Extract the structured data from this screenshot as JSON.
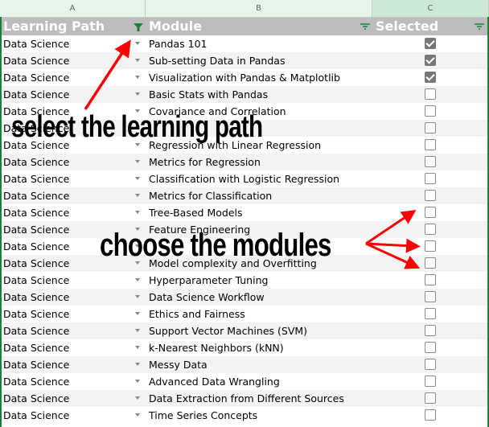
{
  "column_letters": [
    "A",
    "B",
    "C"
  ],
  "headers": {
    "learning_path": "Learning Path",
    "module": "Module",
    "selected": "Selected"
  },
  "colors": {
    "header_bg": "#bdbdbd",
    "filter_icon": "#188038",
    "annotation_arrow": "#ff0000",
    "checkbox_checked": "#777777"
  },
  "rows": [
    {
      "path": "Data Science",
      "module": "Pandas 101",
      "selected": true
    },
    {
      "path": "Data Science",
      "module": "Sub-setting Data in Pandas",
      "selected": true
    },
    {
      "path": "Data Science",
      "module": "Visualization with Pandas & Matplotlib",
      "selected": true
    },
    {
      "path": "Data Science",
      "module": "Basic Stats with Pandas",
      "selected": false
    },
    {
      "path": "Data Science",
      "module": "Covariance and Correlation",
      "selected": false
    },
    {
      "path": "Data Science",
      "module": "",
      "selected": false
    },
    {
      "path": "Data Science",
      "module": "Regression with Linear Regression",
      "selected": false
    },
    {
      "path": "Data Science",
      "module": "Metrics for Regression",
      "selected": false
    },
    {
      "path": "Data Science",
      "module": "Classification with Logistic Regression",
      "selected": false
    },
    {
      "path": "Data Science",
      "module": "Metrics for Classification",
      "selected": false
    },
    {
      "path": "Data Science",
      "module": "Tree-Based Models",
      "selected": false
    },
    {
      "path": "Data Science",
      "module": "Feature Engineering",
      "selected": false
    },
    {
      "path": "Data Science",
      "module": "",
      "selected": false
    },
    {
      "path": "Data Science",
      "module": "Model complexity and Overfitting",
      "selected": false
    },
    {
      "path": "Data Science",
      "module": "Hyperparameter Tuning",
      "selected": false
    },
    {
      "path": "Data Science",
      "module": "Data Science Workflow",
      "selected": false
    },
    {
      "path": "Data Science",
      "module": "Ethics and Fairness",
      "selected": false
    },
    {
      "path": "Data Science",
      "module": "Support Vector Machines (SVM)",
      "selected": false
    },
    {
      "path": "Data Science",
      "module": "k-Nearest Neighbors (kNN)",
      "selected": false
    },
    {
      "path": "Data Science",
      "module": "Messy Data",
      "selected": false
    },
    {
      "path": "Data Science",
      "module": "Advanced Data Wrangling",
      "selected": false
    },
    {
      "path": "Data Science",
      "module": "Data Extraction from Different Sources",
      "selected": false
    },
    {
      "path": "Data Science",
      "module": "Time Series Concepts",
      "selected": false
    }
  ],
  "annotations": {
    "select_path": "select the learning path",
    "choose_modules": "choose the modules"
  }
}
